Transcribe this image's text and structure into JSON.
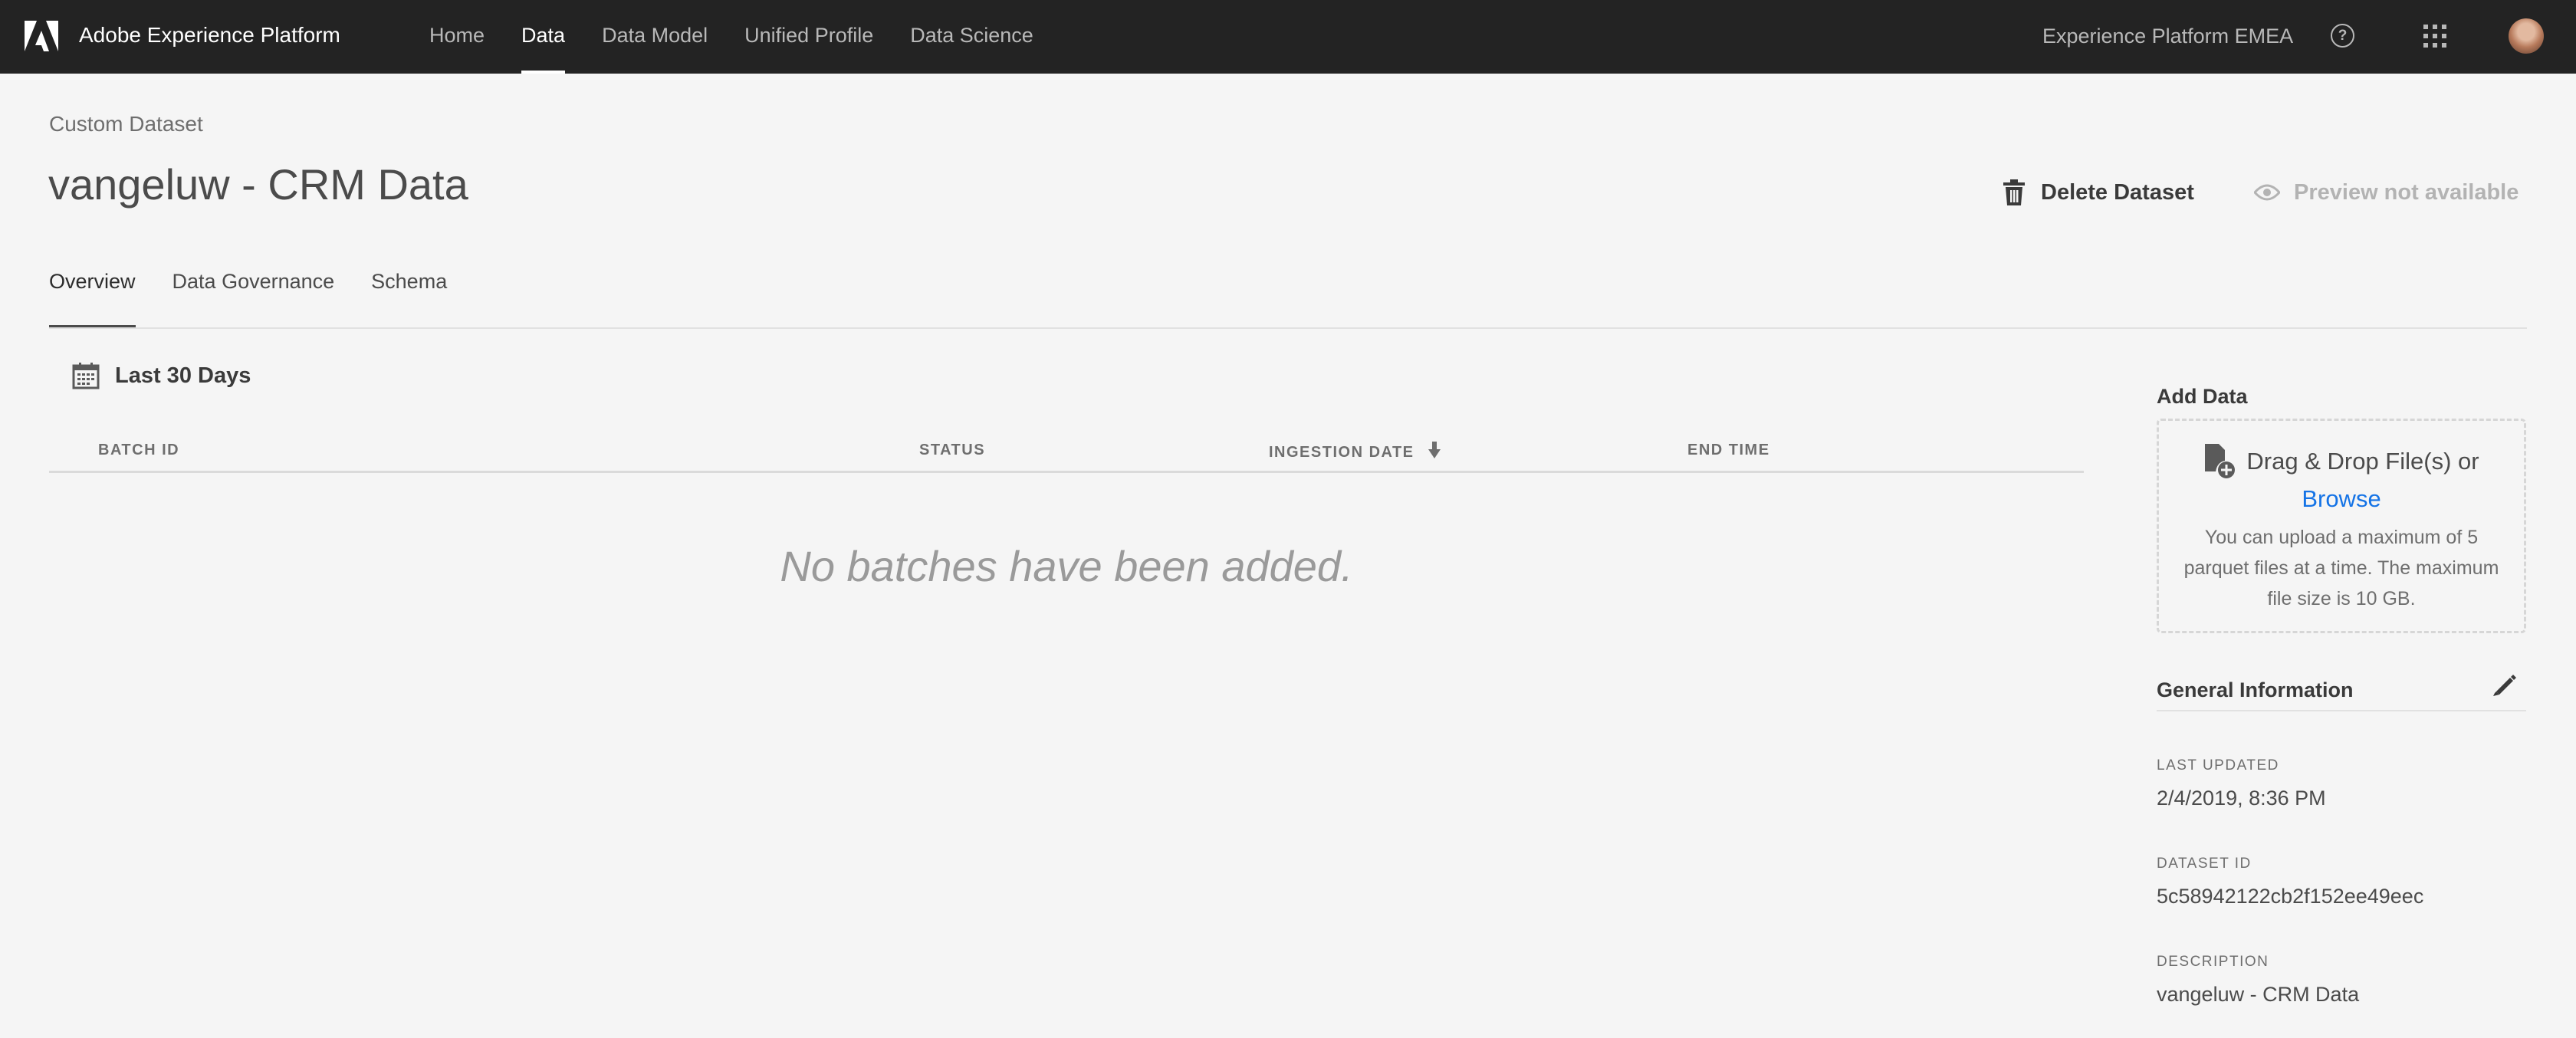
{
  "app": {
    "title": "Adobe Experience Platform",
    "logo_icon": "adobe-logo-icon"
  },
  "nav": {
    "items": [
      {
        "label": "Home",
        "active": false
      },
      {
        "label": "Data",
        "active": true
      },
      {
        "label": "Data Model",
        "active": false
      },
      {
        "label": "Unified Profile",
        "active": false
      },
      {
        "label": "Data Science",
        "active": false
      }
    ],
    "org_name": "Experience Platform EMEA",
    "help_glyph": "?",
    "icons": [
      "help-icon",
      "apps-grid-icon",
      "avatar"
    ]
  },
  "header": {
    "breadcrumb": "Custom Dataset",
    "title": "vangeluw - CRM Data",
    "delete_label": "Delete Dataset",
    "preview_label": "Preview not available"
  },
  "tabs": [
    {
      "label": "Overview",
      "active": true
    },
    {
      "label": "Data Governance",
      "active": false
    },
    {
      "label": "Schema",
      "active": false
    }
  ],
  "filter": {
    "date_range": "Last 30 Days",
    "icon": "calendar-icon"
  },
  "table": {
    "columns": [
      "BATCH ID",
      "STATUS",
      "INGESTION DATE",
      "END TIME"
    ],
    "sorted_column": "INGESTION DATE",
    "sort_direction": "descending",
    "rows": [],
    "empty_message": "No batches have been added."
  },
  "add_data": {
    "heading": "Add Data",
    "drop_text": "Drag & Drop File(s) or",
    "browse_label": "Browse",
    "hint": "You can upload a maximum of 5 parquet files at a time. The maximum file size is 10 GB."
  },
  "general_info": {
    "heading": "General Information",
    "fields": [
      {
        "label": "LAST UPDATED",
        "value": "2/4/2019, 8:36 PM"
      },
      {
        "label": "DATASET ID",
        "value": "5c58942122cb2f152ee49eec"
      },
      {
        "label": "DESCRIPTION",
        "value": "vangeluw - CRM Data"
      }
    ]
  },
  "colors": {
    "topbar": "#232323",
    "background": "#f5f5f5",
    "link": "#1473e6"
  }
}
